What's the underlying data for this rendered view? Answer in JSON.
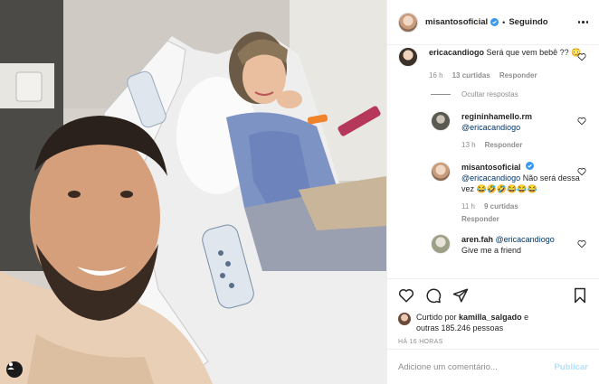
{
  "post": {
    "author": "misantosoficial",
    "separator": "•",
    "follow_state": "Seguindo"
  },
  "comments": [
    {
      "user": "ericacandiogo",
      "text": "Será que vem bebê ?? 😳",
      "time": "16 h",
      "likes": "13 curtidas",
      "reply_label": "Responder"
    }
  ],
  "hide_replies": "Ocultar respostas",
  "replies": [
    {
      "user": "regininhamello.rm",
      "mention": "@ericacandiogo",
      "text": "",
      "time": "13 h",
      "likes": "",
      "reply_label": "Responder"
    },
    {
      "user": "misantosoficial",
      "mention": "@ericacandiogo",
      "text": "Não será dessa vez 😂🤣🤣😂😂😂",
      "time": "11 h",
      "likes": "9 curtidas",
      "reply_label": "Responder"
    },
    {
      "user": "aren.fah",
      "mention": "@ericacandiogo",
      "text": "Give me a friend",
      "time": "",
      "likes": "",
      "reply_label": ""
    }
  ],
  "likes": {
    "prefix": "Curtido por ",
    "user": "kamilla_salgado",
    "middle": " e",
    "others": "outras 185.246 pessoas"
  },
  "timestamp": "HÁ 16 HORAS",
  "add_comment": {
    "placeholder": "Adicione um comentário...",
    "publish_label": "Publicar"
  },
  "colors": {
    "verified": "#3897f0",
    "muted": "#8e8e8e",
    "mention": "#00376b",
    "publish_disabled": "#b2dffc"
  }
}
